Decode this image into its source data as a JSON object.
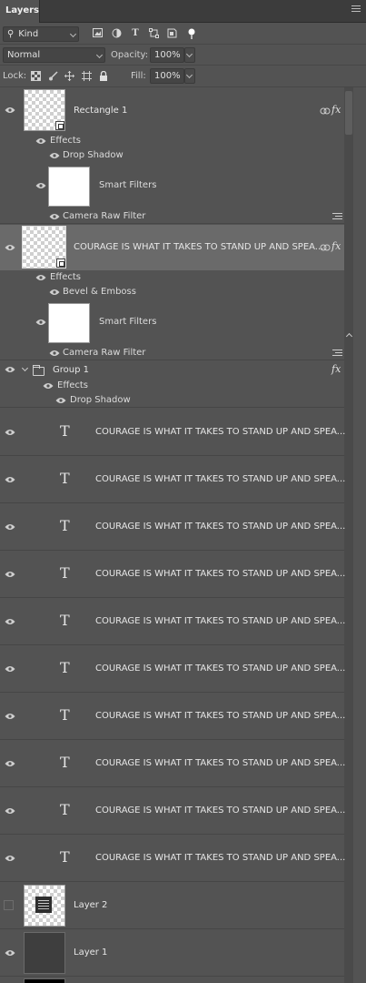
{
  "panel": {
    "tab_label": "Layers"
  },
  "filter": {
    "kind_label": "Kind",
    "icons": [
      "image-filter-icon",
      "adjustment-filter-icon",
      "type-filter-icon",
      "shape-filter-icon",
      "smart-object-filter-icon",
      "filter-toggle-icon"
    ]
  },
  "blend": {
    "mode": "Normal",
    "opacity_label": "Opacity:",
    "opacity_value": "100%"
  },
  "lock": {
    "label": "Lock:",
    "fill_label": "Fill:",
    "fill_value": "100%"
  },
  "layers": {
    "rectangle1": {
      "name": "Rectangle 1",
      "effects": "Effects",
      "effect1": "Drop Shadow",
      "smart_filters": "Smart Filters",
      "filter1": "Camera Raw Filter"
    },
    "courage_smart": {
      "name": "COURAGE IS WHAT IT TAKES TO STAND UP AND SPEA...",
      "effects": "Effects",
      "effect1": "Bevel & Emboss",
      "smart_filters": "Smart Filters",
      "filter1": "Camera Raw Filter"
    },
    "group1": {
      "name": "Group 1",
      "effects": "Effects",
      "effect1": "Drop Shadow"
    },
    "text_layers": [
      "COURAGE IS WHAT IT TAKES TO STAND UP AND SPEA...",
      "COURAGE IS WHAT IT TAKES TO STAND UP AND SPEA...",
      "COURAGE IS WHAT IT TAKES TO STAND UP AND SPEA...",
      "COURAGE IS WHAT IT TAKES TO STAND UP AND SPEA...",
      "COURAGE IS WHAT IT TAKES TO STAND UP AND SPEA...",
      "COURAGE IS WHAT IT TAKES TO STAND UP AND SPEA...",
      "COURAGE IS WHAT IT TAKES TO STAND UP AND SPEA...",
      "COURAGE IS WHAT IT TAKES TO STAND UP AND SPEA...",
      "COURAGE IS WHAT IT TAKES TO STAND UP AND SPEA...",
      "COURAGE IS WHAT IT TAKES TO STAND UP AND SPEA..."
    ],
    "layer2": {
      "name": "Layer 2"
    },
    "layer1": {
      "name": "Layer 1"
    }
  },
  "glyphs": {
    "type_glyph": "T",
    "fx": "fx",
    "fx_icon": "fx-icon"
  },
  "colors": {
    "panel_bg": "#535353",
    "selected_row": "#6a6a6a",
    "tab_bar": "#3c3c3c"
  }
}
